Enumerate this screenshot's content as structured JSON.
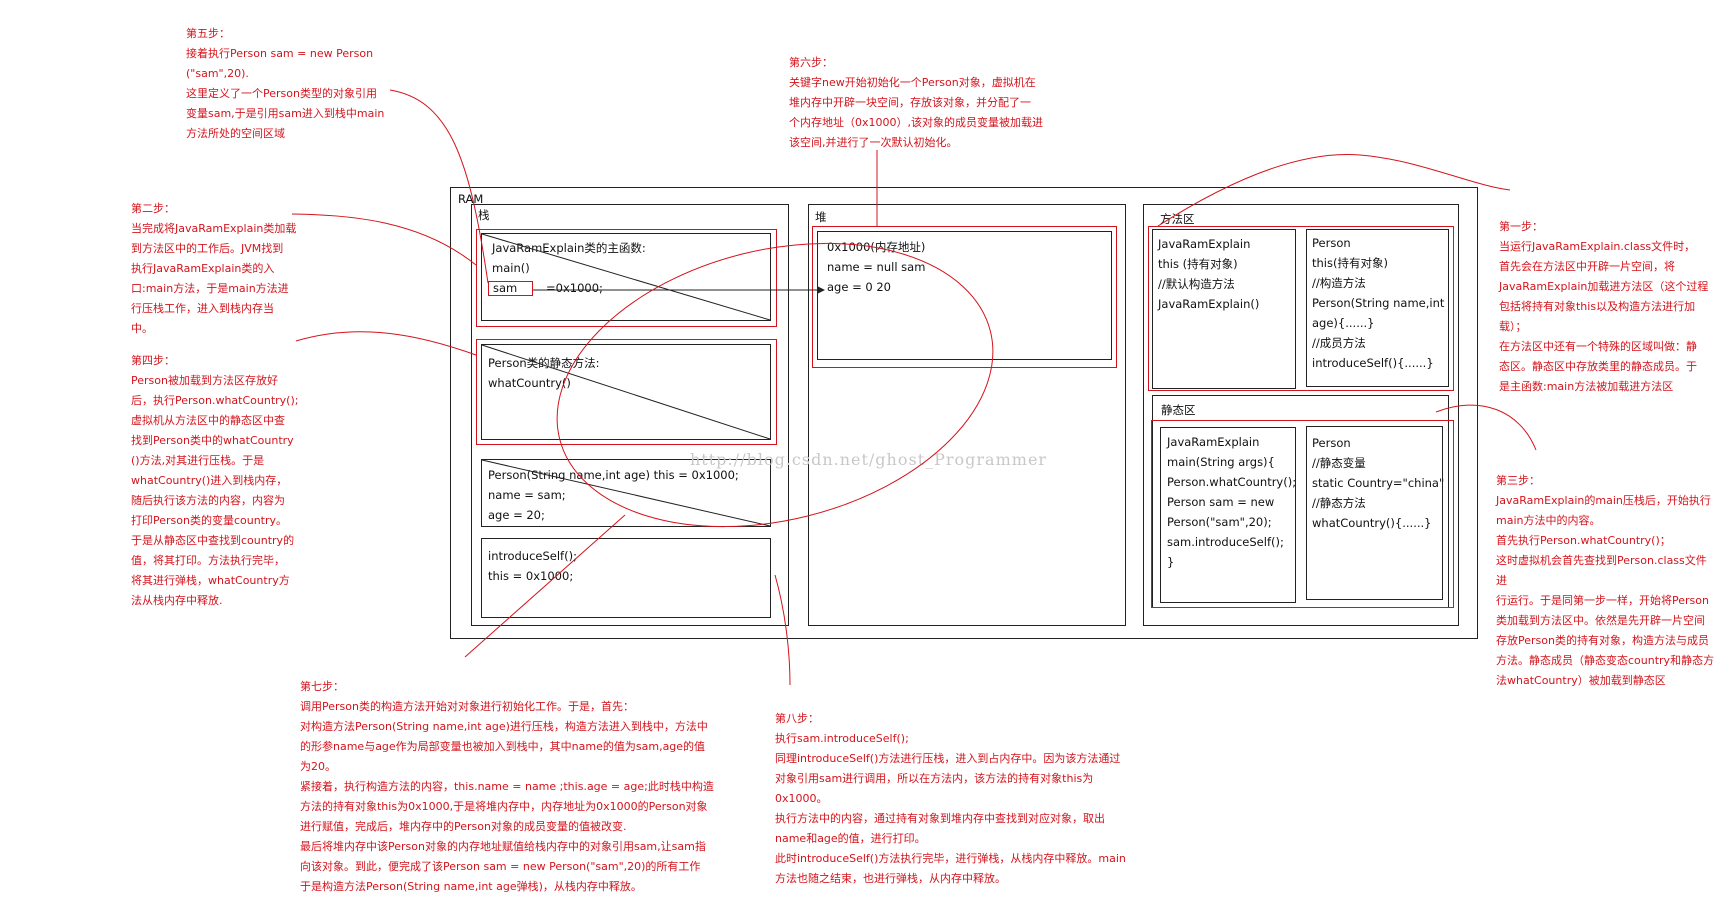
{
  "ram": {
    "label": "RAM"
  },
  "stack": {
    "label": "栈",
    "frame_main": {
      "title": "JavaRamExplain类的主函数:",
      "method": "main()",
      "var": "sam",
      "value": "=0x1000;"
    },
    "frame_static": {
      "title": "Person类的静态方法:",
      "method": "whatCountry()"
    },
    "frame_constructor": {
      "line1": "Person(String name,int age)   this  = 0x1000;",
      "line2": "name = sam;",
      "line3": "age = 20;"
    },
    "frame_introduce": {
      "line1": "introduceSelf();",
      "line2": "this = 0x1000;"
    }
  },
  "heap": {
    "label": "堆",
    "object": {
      "address": "0x1000(内存地址)",
      "name_row": "name = null   sam",
      "age_row": "age = 0           20"
    }
  },
  "method_area": {
    "label": "方法区",
    "class_javaram": {
      "lines": [
        "JavaRamExplain",
        "this (持有对象)",
        "//默认构造方法",
        "JavaRamExplain()"
      ]
    },
    "class_person": {
      "lines": [
        "Person",
        "this(持有对象)",
        "//构造方法",
        "Person(String name,int",
        "age){......}",
        "//成员方法",
        "introduceSelf(){......}"
      ]
    },
    "static_area": {
      "label": "静态区",
      "javaram_static": {
        "lines": [
          "JavaRamExplain",
          "main(String args){",
          "Person.whatCountry();",
          "Person sam = new",
          "Person(\"sam\",20);",
          "sam.introduceSelf();",
          "}"
        ]
      },
      "person_static": {
        "lines": [
          "Person",
          "//静态变量",
          "static Country=\"china\"",
          "//静态方法",
          "whatCountry(){......}"
        ]
      }
    }
  },
  "watermark": "http://blog.csdn.net/ghost_Programmer",
  "steps": {
    "step1": {
      "title": "第一步：",
      "body": "当运行JavaRamExplain.class文件时，\n首先会在方法区中开辟一片空间，将\nJavaRamExplain加载进方法区（这个过程\n包括将持有对象this以及构造方法进行加\n载）；\n在方法区中还有一个特殊的区域叫做：静\n态区。静态区中存放类里的静态成员。于\n是主函数:main方法被加载进方法区"
    },
    "step2": {
      "title": "第二步：",
      "body": "当完成将JavaRamExplain类加载\n到方法区中的工作后。JVM找到\n执行JavaRamExplain类的入\n口:main方法，于是main方法进\n行压栈工作，进入到栈内存当\n中。"
    },
    "step3": {
      "title": "第三步：",
      "body": "JavaRamExplain的main压栈后，开始执行\nmain方法中的内容。\n首先执行Person.whatCountry()；\n这时虚拟机会首先查找到Person.class文件进\n行运行。于是同第一步一样，开始将Person\n类加载到方法区中。依然是先开辟一片空间\n存放Person类的持有对象，构造方法与成员\n方法。静态成员（静态变态country和静态方\n法whatCountry）被加载到静态区"
    },
    "step4": {
      "title": "第四步：",
      "body": "Person被加载到方法区存放好\n后，执行Person.whatCountry();\n虚拟机从方法区中的静态区中查\n找到Person类中的whatCountry\n()方法,对其进行压栈。于是\nwhatCountry()进入到栈内存，\n随后执行该方法的内容，内容为\n打印Person类的变量country。\n于是从静态区中查找到country的\n值，将其打印。方法执行完毕，\n将其进行弹栈，whatCountry方\n法从栈内存中释放."
    },
    "step5": {
      "title": "第五步：",
      "body": "接着执行Person sam = new Person\n(\"sam\",20).\n这里定义了一个Person类型的对象引用\n变量sam,于是引用sam进入到栈中main\n方法所处的空间区域"
    },
    "step6": {
      "title": "第六步：",
      "body": "关键字new开始初始化一个Person对象，虚拟机在\n堆内存中开辟一块空间，存放该对象，并分配了一\n个内存地址（0x1000）,该对象的成员变量被加载进\n该空间,并进行了一次默认初始化。"
    },
    "step7": {
      "title": "第七步：",
      "body": "调用Person类的构造方法开始对对象进行初始化工作。于是，首先：\n对构造方法Person(String name,int age)进行压栈，构造方法进入到栈中，方法中\n的形参name与age作为局部变量也被加入到栈中，其中name的值为sam,age的值\n为20。\n紧接着，执行构造方法的内容，this.name = name ;this.age = age;此时栈中构造\n方法的持有对象this为0x1000,于是将堆内存中，内存地址为0x1000的Person对象\n进行赋值，完成后，堆内存中的Person对象的成员变量的值被改变.\n最后将堆内存中该Person对象的内存地址赋值给栈内存中的对象引用sam,让sam指\n向该对象。到此，便完成了该Person sam = new Person(\"sam\",20)的所有工作\n于是构造方法Person(String name,int age弹栈)，从栈内存中释放。"
    },
    "step8": {
      "title": "第八步：",
      "body": "执行sam.introduceSelf();\n同理introduceSelf()方法进行压栈，进入到占内存中。因为该方法通过\n对象引用sam进行调用，所以在方法内，该方法的持有对象this为\n0x1000。\n执行方法中的内容，通过持有对象到堆内存中查找到对应对象，取出\nname和age的值，进行打印。\n此时introduceSelf()方法执行完毕，进行弹栈，从栈内存中释放。main\n方法也随之结束，也进行弹栈，从内存中释放。"
    }
  }
}
